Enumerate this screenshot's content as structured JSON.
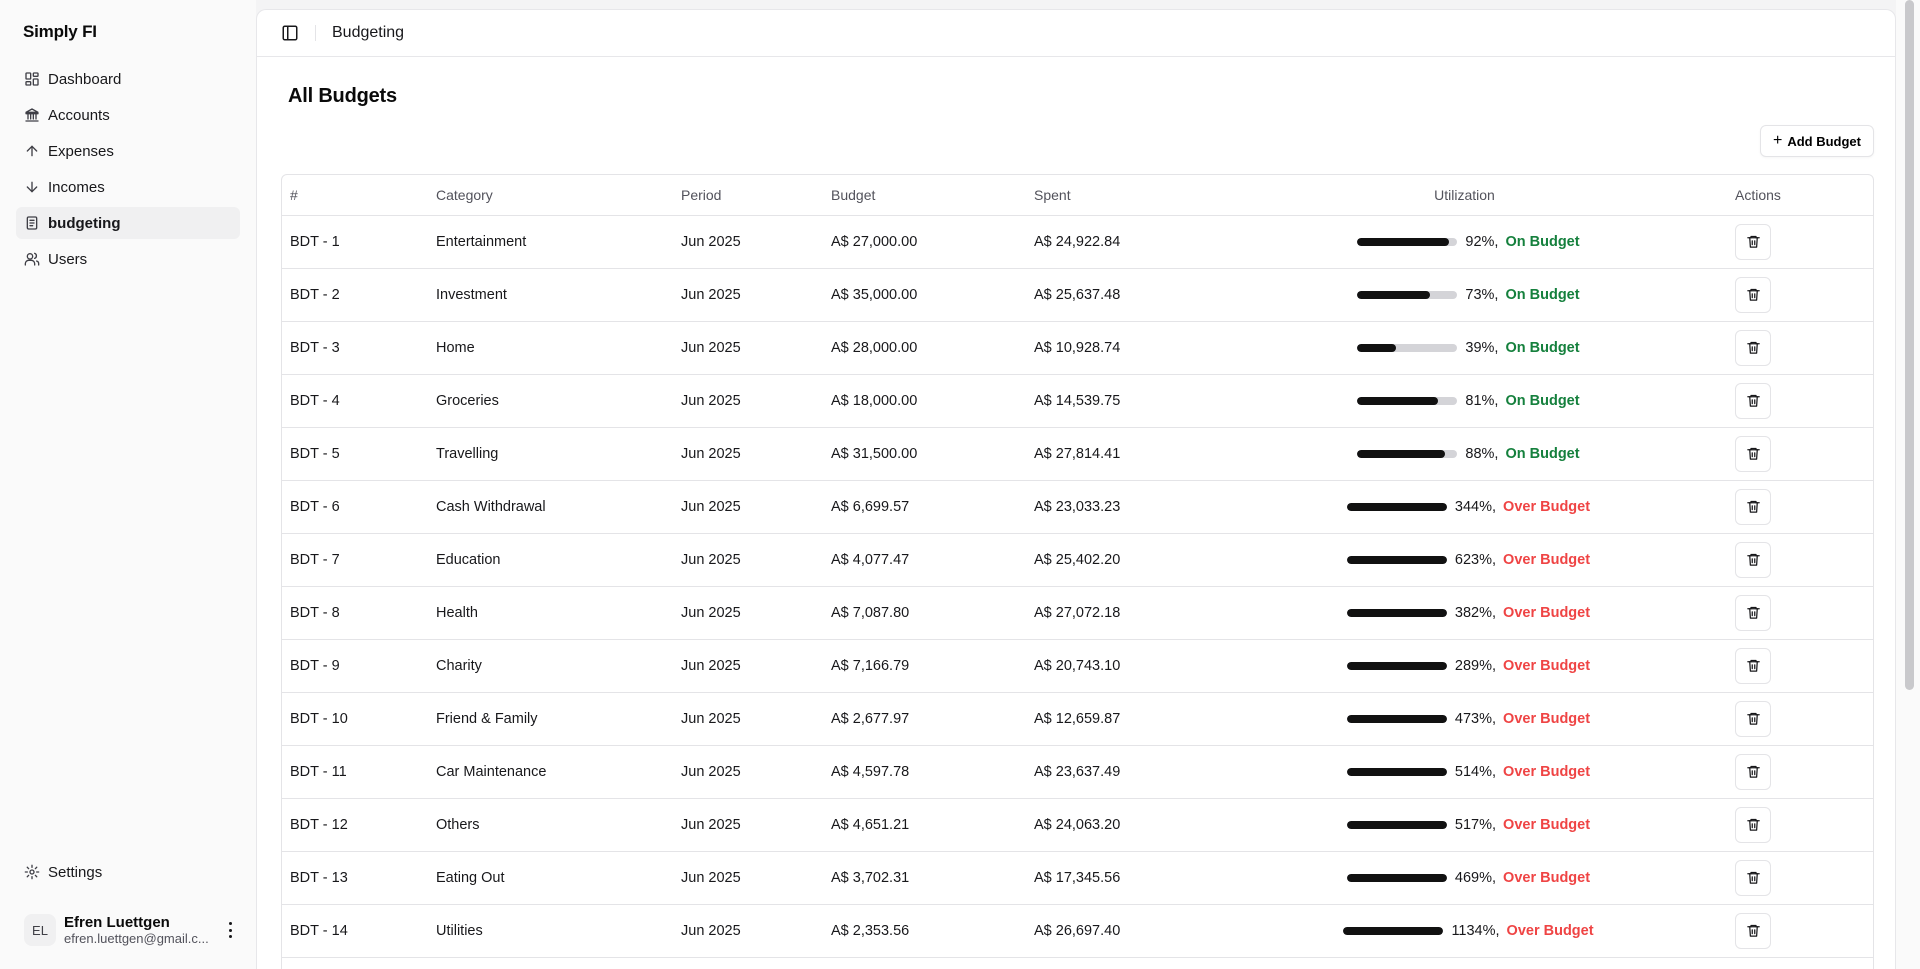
{
  "app": {
    "name": "Simply FI"
  },
  "sidebar": {
    "items": [
      {
        "label": "Dashboard",
        "icon": "dashboard-icon"
      },
      {
        "label": "Accounts",
        "icon": "bank-icon"
      },
      {
        "label": "Expenses",
        "icon": "arrow-up-icon"
      },
      {
        "label": "Incomes",
        "icon": "arrow-down-icon"
      },
      {
        "label": "budgeting",
        "icon": "receipt-icon",
        "active": true
      },
      {
        "label": "Users",
        "icon": "users-icon"
      }
    ],
    "settings_label": "Settings"
  },
  "user": {
    "initials": "EL",
    "name": "Efren Luettgen",
    "email": "efren.luettgen@gmail.c..."
  },
  "header": {
    "breadcrumb": "Budgeting"
  },
  "page": {
    "title": "All Budgets",
    "add_button": "Add Budget"
  },
  "table": {
    "columns": [
      "#",
      "Category",
      "Period",
      "Budget",
      "Spent",
      "Utilization",
      "Actions"
    ],
    "rows": [
      {
        "id": "BDT - 1",
        "category": "Entertainment",
        "period": "Jun 2025",
        "budget": "A$ 27,000.00",
        "spent": "A$ 24,922.84",
        "utilization": "92%,",
        "fill": 0.92,
        "status": "On Budget",
        "over": false
      },
      {
        "id": "BDT - 2",
        "category": "Investment",
        "period": "Jun 2025",
        "budget": "A$ 35,000.00",
        "spent": "A$ 25,637.48",
        "utilization": "73%,",
        "fill": 0.73,
        "status": "On Budget",
        "over": false
      },
      {
        "id": "BDT - 3",
        "category": "Home",
        "period": "Jun 2025",
        "budget": "A$ 28,000.00",
        "spent": "A$ 10,928.74",
        "utilization": "39%,",
        "fill": 0.39,
        "status": "On Budget",
        "over": false
      },
      {
        "id": "BDT - 4",
        "category": "Groceries",
        "period": "Jun 2025",
        "budget": "A$ 18,000.00",
        "spent": "A$ 14,539.75",
        "utilization": "81%,",
        "fill": 0.81,
        "status": "On Budget",
        "over": false
      },
      {
        "id": "BDT - 5",
        "category": "Travelling",
        "period": "Jun 2025",
        "budget": "A$ 31,500.00",
        "spent": "A$ 27,814.41",
        "utilization": "88%,",
        "fill": 0.88,
        "status": "On Budget",
        "over": false
      },
      {
        "id": "BDT - 6",
        "category": "Cash Withdrawal",
        "period": "Jun 2025",
        "budget": "A$ 6,699.57",
        "spent": "A$ 23,033.23",
        "utilization": "344%,",
        "fill": 1,
        "status": "Over Budget",
        "over": true
      },
      {
        "id": "BDT - 7",
        "category": "Education",
        "period": "Jun 2025",
        "budget": "A$ 4,077.47",
        "spent": "A$ 25,402.20",
        "utilization": "623%,",
        "fill": 1,
        "status": "Over Budget",
        "over": true
      },
      {
        "id": "BDT - 8",
        "category": "Health",
        "period": "Jun 2025",
        "budget": "A$ 7,087.80",
        "spent": "A$ 27,072.18",
        "utilization": "382%,",
        "fill": 1,
        "status": "Over Budget",
        "over": true
      },
      {
        "id": "BDT - 9",
        "category": "Charity",
        "period": "Jun 2025",
        "budget": "A$ 7,166.79",
        "spent": "A$ 20,743.10",
        "utilization": "289%,",
        "fill": 1,
        "status": "Over Budget",
        "over": true
      },
      {
        "id": "BDT - 10",
        "category": "Friend & Family",
        "period": "Jun 2025",
        "budget": "A$ 2,677.97",
        "spent": "A$ 12,659.87",
        "utilization": "473%,",
        "fill": 1,
        "status": "Over Budget",
        "over": true
      },
      {
        "id": "BDT - 11",
        "category": "Car Maintenance",
        "period": "Jun 2025",
        "budget": "A$ 4,597.78",
        "spent": "A$ 23,637.49",
        "utilization": "514%,",
        "fill": 1,
        "status": "Over Budget",
        "over": true
      },
      {
        "id": "BDT - 12",
        "category": "Others",
        "period": "Jun 2025",
        "budget": "A$ 4,651.21",
        "spent": "A$ 24,063.20",
        "utilization": "517%,",
        "fill": 1,
        "status": "Over Budget",
        "over": true
      },
      {
        "id": "BDT - 13",
        "category": "Eating Out",
        "period": "Jun 2025",
        "budget": "A$ 3,702.31",
        "spent": "A$ 17,345.56",
        "utilization": "469%,",
        "fill": 1,
        "status": "Over Budget",
        "over": true
      },
      {
        "id": "BDT - 14",
        "category": "Utilities",
        "period": "Jun 2025",
        "budget": "A$ 2,353.56",
        "spent": "A$ 26,697.40",
        "utilization": "1134%,",
        "fill": 1,
        "status": "Over Budget",
        "over": true
      },
      {
        "id": "",
        "category": "",
        "period": "",
        "budget": "",
        "spent": "",
        "utilization": "",
        "fill": 0,
        "status": "",
        "over": false
      }
    ]
  },
  "colors": {
    "on_budget": "#15803d",
    "over_budget": "#ef4444",
    "bar": "#111111",
    "bar_track": "#d4d4d8"
  }
}
